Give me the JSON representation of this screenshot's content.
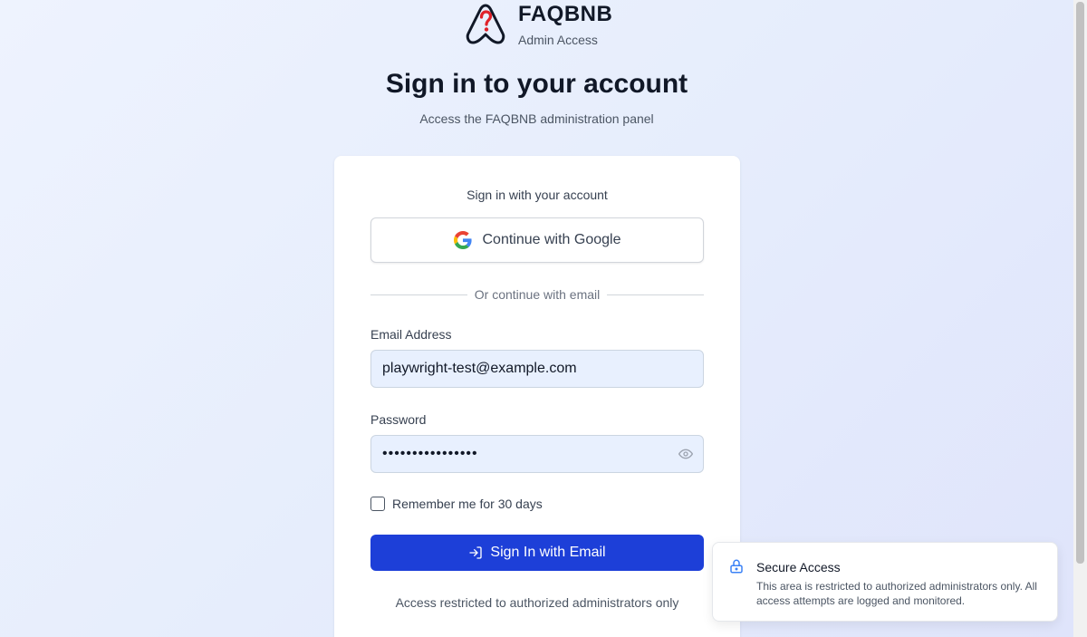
{
  "brand": {
    "name": "FAQBNB",
    "subtitle": "Admin Access",
    "logo_icon": "airbnb-question-logo-icon"
  },
  "header": {
    "title": "Sign in to your account",
    "subtitle": "Access the FAQBNB administration panel"
  },
  "card": {
    "heading": "Sign in with your account",
    "google_button": "Continue with Google",
    "divider": "Or continue with email",
    "email": {
      "label": "Email Address",
      "value": "playwright-test@example.com"
    },
    "password": {
      "label": "Password",
      "value": "••••••••••••••••"
    },
    "remember_label": "Remember me for 30 days",
    "remember_checked": false,
    "signin_button": "Sign In with Email",
    "restricted_note": "Access restricted to authorized administrators only"
  },
  "toast": {
    "title": "Secure Access",
    "message": "This area is restricted to authorized administrators only. All access attempts are logged and monitored.",
    "icon": "lock-icon"
  },
  "colors": {
    "primary": "#1d3fd8",
    "logo_accent": "#e0222a",
    "lock_icon": "#3b82f6"
  }
}
